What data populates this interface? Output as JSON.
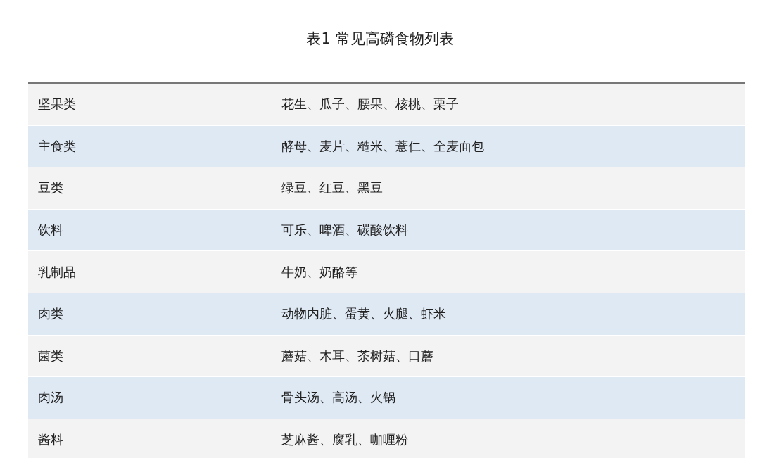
{
  "title": "表1 常见高磷食物列表",
  "rows": [
    {
      "category": "坚果类",
      "foods": "花生、瓜子、腰果、核桃、栗子"
    },
    {
      "category": "主食类",
      "foods": "酵母、麦片、糙米、薏仁、全麦面包"
    },
    {
      "category": "豆类",
      "foods": "绿豆、红豆、黑豆"
    },
    {
      "category": "饮料",
      "foods": "可乐、啤酒、碳酸饮料"
    },
    {
      "category": "乳制品",
      "foods": "牛奶、奶酪等"
    },
    {
      "category": "肉类",
      "foods": "动物内脏、蛋黄、火腿、虾米"
    },
    {
      "category": "菌类",
      "foods": "蘑菇、木耳、茶树菇、口蘑"
    },
    {
      "category": "肉汤",
      "foods": "骨头汤、高汤、火锅"
    },
    {
      "category": "酱料",
      "foods": "芝麻酱、腐乳、咖喱粉"
    }
  ]
}
